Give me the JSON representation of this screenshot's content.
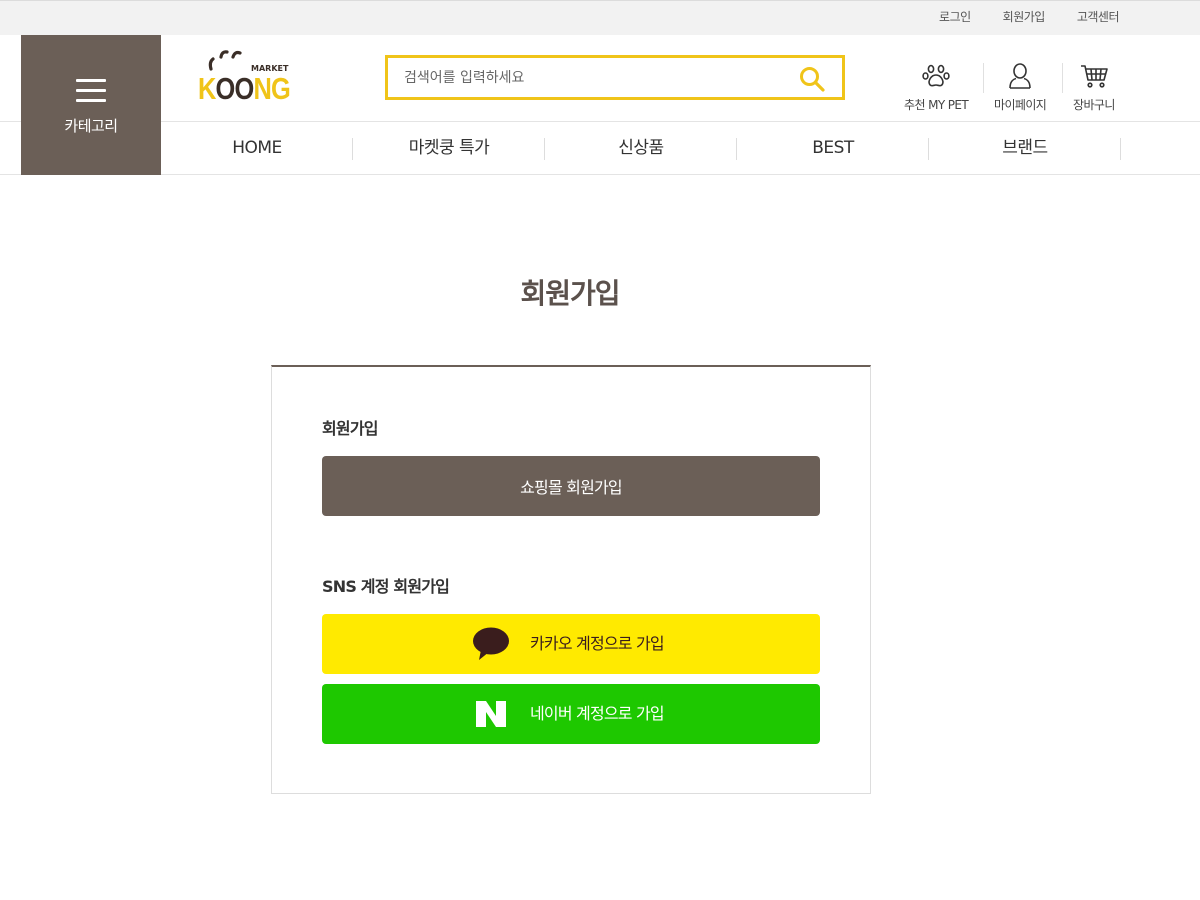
{
  "top_links": {
    "login": "로그인",
    "join": "회원가입",
    "support": "고객센터"
  },
  "header": {
    "category_label": "카테고리",
    "logo": {
      "word_left": "K",
      "word_oo": "OO",
      "word_right": "NG",
      "market": "MARKET"
    },
    "search_placeholder": "검색어를 입력하세요",
    "quick": {
      "mypet": "추천 MY PET",
      "mypage": "마이페이지",
      "cart": "장바구니"
    }
  },
  "gnb": [
    "HOME",
    "마켓쿵 특가",
    "신상품",
    "BEST",
    "브랜드"
  ],
  "page_title": "회원가입",
  "join": {
    "member_title": "회원가입",
    "shop_button": "쇼핑몰 회원가입",
    "sns_title": "SNS 계정 회원가입",
    "kakao_button": "카카오 계정으로 가입",
    "naver_button": "네이버 계정으로 가입"
  },
  "colors": {
    "brown": "#6b5f57",
    "yellow": "#f0c419",
    "kakao": "#ffea00",
    "naver": "#1ec800"
  }
}
